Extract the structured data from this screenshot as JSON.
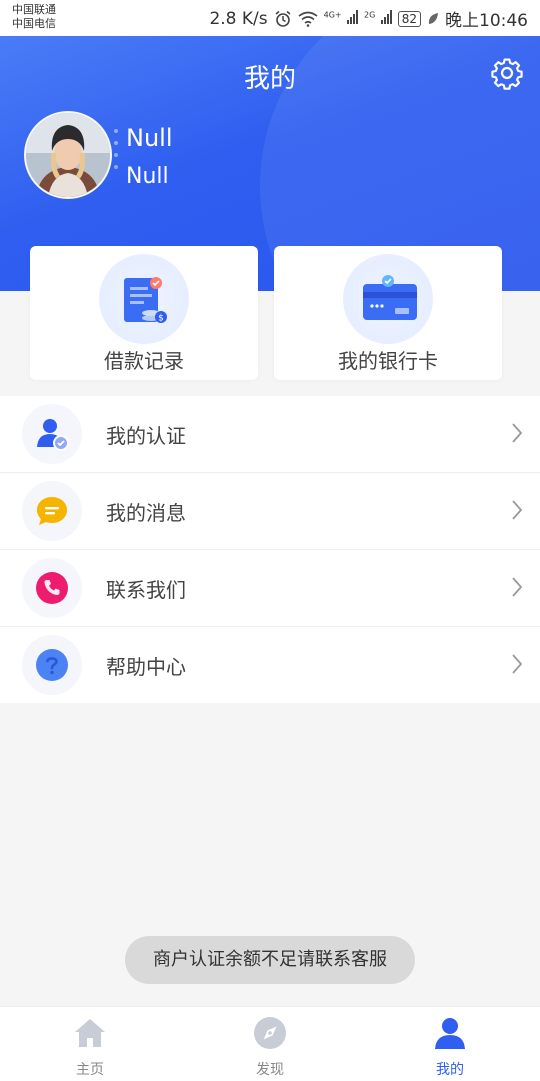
{
  "status_bar": {
    "carrier1": "中国联通",
    "carrier2": "中国电信",
    "speed": "2.8 K/s",
    "network1": "4G+",
    "network2": "2G",
    "battery": "82",
    "time": "晚上10:46"
  },
  "header": {
    "title": "我的",
    "user_name": "Null",
    "user_sub": "Null"
  },
  "cards": [
    {
      "label": "借款记录"
    },
    {
      "label": "我的银行卡"
    }
  ],
  "menu": [
    {
      "label": "我的认证",
      "icon": "user-verified-icon"
    },
    {
      "label": "我的消息",
      "icon": "message-icon"
    },
    {
      "label": "联系我们",
      "icon": "phone-icon"
    },
    {
      "label": "帮助中心",
      "icon": "help-icon"
    }
  ],
  "toast": "商户认证余额不足请联系客服",
  "tabs": [
    {
      "label": "主页",
      "icon": "home-icon",
      "active": false
    },
    {
      "label": "发现",
      "icon": "compass-icon",
      "active": false
    },
    {
      "label": "我的",
      "icon": "person-icon",
      "active": true
    }
  ],
  "colors": {
    "primary": "#2f5ef0",
    "toast_bg": "#d9d9d9",
    "inactive_tab": "#c8ccd6"
  }
}
